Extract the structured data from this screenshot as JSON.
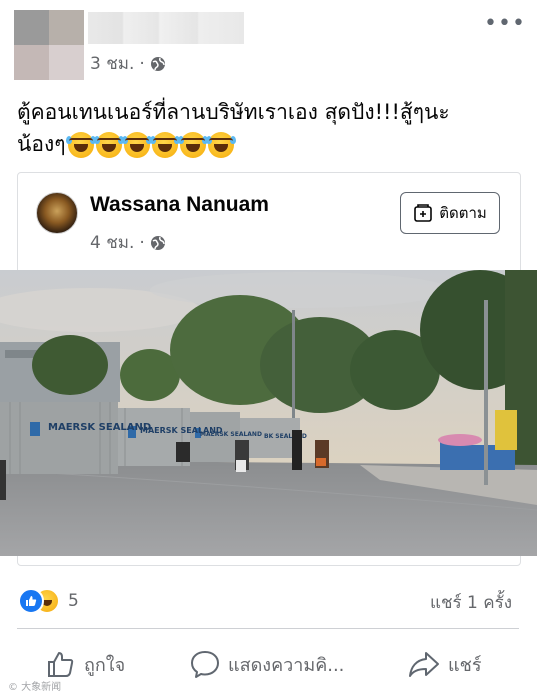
{
  "post": {
    "time": "3 ชม.",
    "privacy_icon": "globe-icon",
    "caption_line1": "ตู้คอนเทนเนอร์ที่ลานบริษัทเราเอง สุดปัง!!!สู้ๆนะ",
    "caption_line2": "น้องๆ",
    "emoji_count": 6
  },
  "shared": {
    "name": "Wassana Nanuam",
    "time": "4 ชม.",
    "follow_label": "ติดตาม"
  },
  "photo": {
    "container_text_1": "MAERSK SEALAND",
    "container_text_2": "MAERSK SEALAND",
    "container_text_3": "MAERSK SEALAND",
    "container_text_4": "BK SEALAND"
  },
  "stats": {
    "reaction_count": "5",
    "shares": "แชร์ 1 ครั้ง"
  },
  "actions": {
    "like": "ถูกใจ",
    "comment": "แสดงความคิ...",
    "share": "แชร์"
  },
  "watermark": "© 大象新闻",
  "colors": {
    "accent": "#1877f2",
    "muted": "#65676b"
  }
}
